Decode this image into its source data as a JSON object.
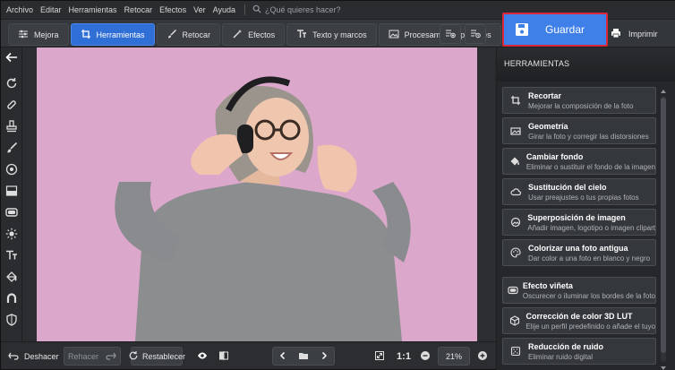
{
  "menu": {
    "items": [
      "Archivo",
      "Editar",
      "Herramientas",
      "Retocar",
      "Efectos",
      "Ver",
      "Ayuda"
    ],
    "search_placeholder": "¿Qué quieres hacer?"
  },
  "toolbar": {
    "tabs": [
      "Mejora",
      "Herramientas",
      "Retocar",
      "Efectos",
      "Texto y marcos",
      "Procesamiento por lotes"
    ],
    "active_tab": "Herramientas",
    "save_label": "Guardar",
    "print_label": "Imprimir"
  },
  "bottom": {
    "undo_label": "Deshacer",
    "redo_label": "Rehacer",
    "reset_label": "Restablecer",
    "zoom_ratio": "1:1",
    "zoom_percent": "21%"
  },
  "panel": {
    "header": "HERRAMIENTAS",
    "items": [
      {
        "title": "Recortar",
        "desc": "Mejorar la composición de la foto",
        "icon": "crop-icon"
      },
      {
        "title": "Geometría",
        "desc": "Girar la foto y corregir las distorsiones",
        "icon": "geometry-icon"
      },
      {
        "title": "Cambiar fondo",
        "desc": "Eliminar o sustituir el fondo de la imagen",
        "icon": "fill-bucket-icon"
      },
      {
        "title": "Sustitución del cielo",
        "desc": "Usar preajustes o tus propias fotos",
        "icon": "cloud-icon"
      },
      {
        "title": "Superposición de imagen",
        "desc": "Añadir imagen, logotipo o imagen clipart",
        "icon": "layers-icon"
      },
      {
        "title": "Colorizar una foto antigua",
        "desc": "Dar color a una foto en blanco y negro",
        "icon": "palette-icon"
      },
      {
        "title": "Efecto viñeta",
        "desc": "Oscurecer o iluminar los bordes de la foto",
        "icon": "vignette-icon"
      },
      {
        "title": "Corrección de color 3D LUT",
        "desc": "Elije un perfil predefinido o añade el tuyo",
        "icon": "cube-icon"
      },
      {
        "title": "Reducción de ruido",
        "desc": "Eliminar ruido digital",
        "icon": "noise-reduction-icon"
      }
    ]
  },
  "colors": {
    "accent": "#3f7fe8",
    "highlight_border": "#d9283a",
    "photo_background": "#dba8cc"
  }
}
